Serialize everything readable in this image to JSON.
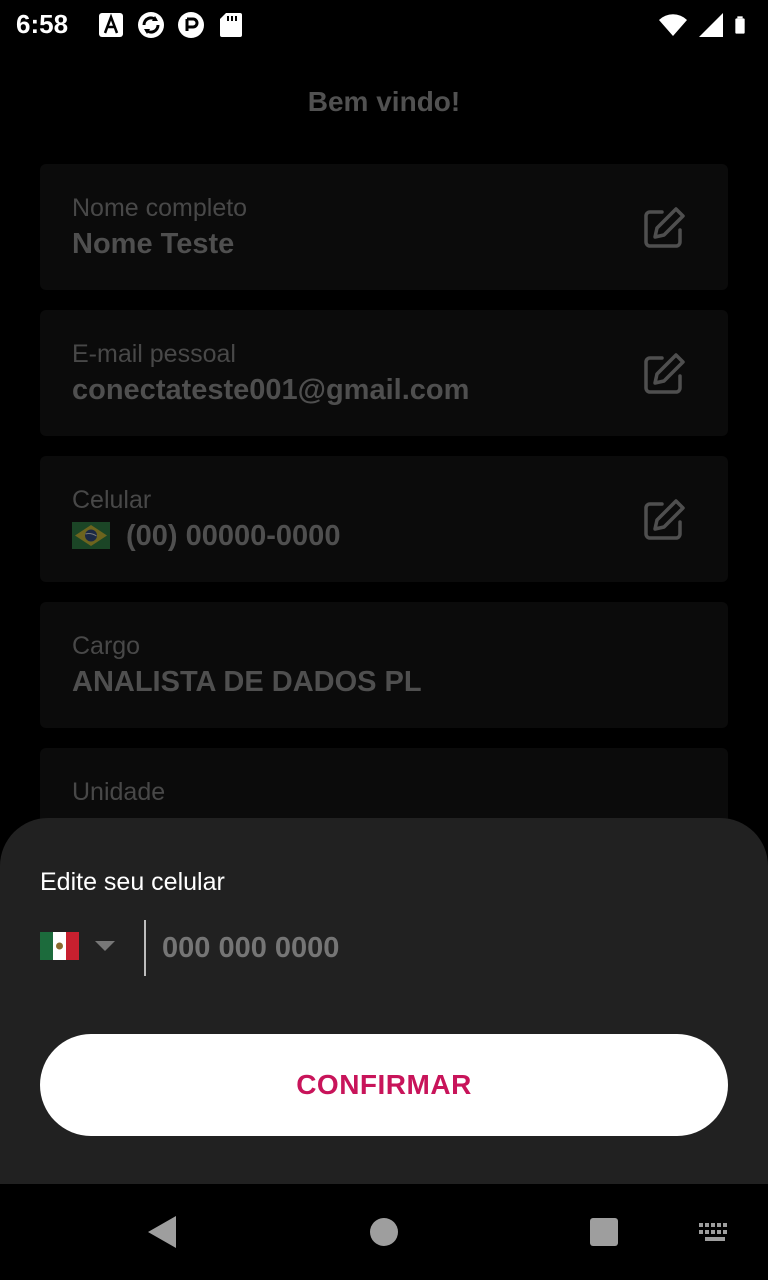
{
  "status_bar": {
    "time": "6:58",
    "left_icons": [
      "font-icon",
      "sync-icon",
      "hand-icon",
      "sd-card-icon"
    ],
    "right_icons": [
      "wifi-icon",
      "signal-icon",
      "battery-icon"
    ]
  },
  "page": {
    "title": "Bem vindo!"
  },
  "fields": [
    {
      "label": "Nome completo",
      "value": "Nome Teste",
      "editable": true
    },
    {
      "label": "E-mail pessoal",
      "value": "conectateste001@gmail.com",
      "editable": true
    },
    {
      "label": "Celular",
      "value": "(00) 00000-0000",
      "editable": true,
      "flag": "brazil-flag-icon"
    },
    {
      "label": "Cargo",
      "value": "ANALISTA DE DADOS PL",
      "editable": false
    },
    {
      "label": "Unidade",
      "value": "",
      "editable": false
    }
  ],
  "sheet": {
    "title": "Edite seu celular",
    "country_flag": "mexico-flag-icon",
    "phone_placeholder": "000 000 0000",
    "confirm_label": "CONFIRMAR"
  },
  "colors": {
    "accent": "#c8145a",
    "sheet_bg": "#212121",
    "card_bg": "#111111"
  },
  "nav_bar": {
    "buttons": [
      "back-icon",
      "home-icon",
      "recents-icon",
      "keyboard-icon"
    ]
  }
}
